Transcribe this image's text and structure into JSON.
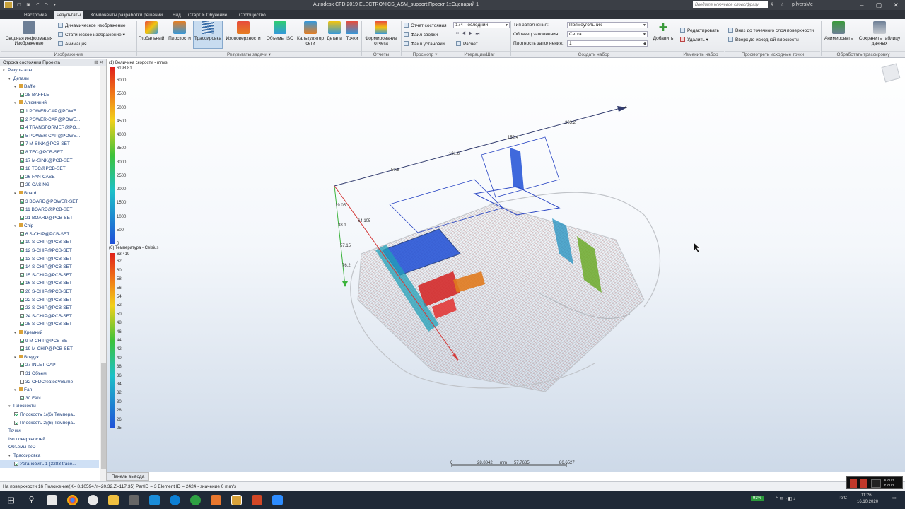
{
  "titlebar": {
    "title": "Autodesk CFD 2019   ELECTRONICS_ASM_support:Проект 1::Сценарий 1",
    "search_placeholder": "Введите ключевое слово/фразу",
    "user": "pilversMe"
  },
  "menu": [
    "Настройка",
    "Результаты",
    "Компоненты разработки решений",
    "Вид",
    "Старт & Обучение",
    "Сообщество"
  ],
  "ribbon": {
    "image": {
      "label": "Сводная информация Изображение",
      "dyn": "Динамическое изображение",
      "static": "Статическое изображение",
      "anim": "Анимация",
      "group": "Изображение"
    },
    "tasks": [
      "Глобальный",
      "Плоскости",
      "Трассировка",
      "Изоповерхности",
      "Объемы ISO",
      "Калькулятор сети",
      "Детали",
      "Точки"
    ],
    "tasks_group": "Результаты задачи",
    "report": {
      "label": "Формирование отчета",
      "group": "Отчеты"
    },
    "review": {
      "status": "Отчет состояния",
      "status_val": "174 Последний",
      "summary": "Файл сводки",
      "setup": "Файл установки",
      "calc": "Расчет",
      "group": "Просмотр",
      "group2": "Итерации/Шаг"
    },
    "set": {
      "type_label": "Тип заполнения:",
      "type_val": "Прямоугольник",
      "pattern_label": "Образец заполнения:",
      "pattern_val": "Сетка",
      "density_label": "Плотность заполнения:",
      "density_val": "1",
      "add": "Добавить",
      "group": "Создать набор"
    },
    "edit": {
      "edit": "Редактировать",
      "delete": "Удалить",
      "group": "Изменить набор"
    },
    "seed": {
      "top": "Вниз до точечного слоя поверхности",
      "up": "Вверх до исходной плоскости",
      "group": "Просмотреть исходные точки"
    },
    "process": {
      "animate": "Анимировать",
      "save": "Сохранить таблицу данных",
      "group": "Обработать трассировку"
    }
  },
  "tree": {
    "header": "Строка состояния Проекта",
    "items": [
      {
        "lvl": 0,
        "kind": "tw",
        "text": "Результаты"
      },
      {
        "lvl": 1,
        "kind": "tw",
        "text": "Детали"
      },
      {
        "lvl": 2,
        "kind": "fo",
        "text": "Baffle"
      },
      {
        "lvl": 3,
        "kind": "on",
        "text": "28 BAFFLE"
      },
      {
        "lvl": 2,
        "kind": "fo",
        "text": "Алюминий"
      },
      {
        "lvl": 3,
        "kind": "on",
        "text": "1 POWER-CAP@POWE..."
      },
      {
        "lvl": 3,
        "kind": "on",
        "text": "2 POWER-CAP@POWE..."
      },
      {
        "lvl": 3,
        "kind": "on",
        "text": "4 TRANSFORMER@PO..."
      },
      {
        "lvl": 3,
        "kind": "on",
        "text": "5 POWER-CAP@POWE..."
      },
      {
        "lvl": 3,
        "kind": "on",
        "text": "7 M-SINK@PCB-SET"
      },
      {
        "lvl": 3,
        "kind": "on",
        "text": "8 TEC@PCB-SET"
      },
      {
        "lvl": 3,
        "kind": "on",
        "text": "17 M-SINK@PCB-SET"
      },
      {
        "lvl": 3,
        "kind": "on",
        "text": "18 TEC@PCB-SET"
      },
      {
        "lvl": 3,
        "kind": "on",
        "text": "26 FAN-CASE"
      },
      {
        "lvl": 3,
        "kind": "off",
        "text": "29 CASING"
      },
      {
        "lvl": 2,
        "kind": "fo",
        "text": "Board"
      },
      {
        "lvl": 3,
        "kind": "on",
        "text": "3 BOARD@POWER-SET"
      },
      {
        "lvl": 3,
        "kind": "on",
        "text": "11 BOARD@PCB-SET"
      },
      {
        "lvl": 3,
        "kind": "on",
        "text": "21 BOARD@PCB-SET"
      },
      {
        "lvl": 2,
        "kind": "fo",
        "text": "Chip"
      },
      {
        "lvl": 3,
        "kind": "on",
        "text": "6 S-CHIP@PCB-SET"
      },
      {
        "lvl": 3,
        "kind": "on",
        "text": "10 S-CHIP@PCB-SET"
      },
      {
        "lvl": 3,
        "kind": "on",
        "text": "12 S-CHIP@PCB-SET"
      },
      {
        "lvl": 3,
        "kind": "on",
        "text": "13 S-CHIP@PCB-SET"
      },
      {
        "lvl": 3,
        "kind": "on",
        "text": "14 S-CHIP@PCB-SET"
      },
      {
        "lvl": 3,
        "kind": "on",
        "text": "15 S-CHIP@PCB-SET"
      },
      {
        "lvl": 3,
        "kind": "on",
        "text": "16 S-CHIP@PCB-SET"
      },
      {
        "lvl": 3,
        "kind": "on",
        "text": "20 S-CHIP@PCB-SET"
      },
      {
        "lvl": 3,
        "kind": "on",
        "text": "22 S-CHIP@PCB-SET"
      },
      {
        "lvl": 3,
        "kind": "on",
        "text": "23 S-CHIP@PCB-SET"
      },
      {
        "lvl": 3,
        "kind": "on",
        "text": "24 S-CHIP@PCB-SET"
      },
      {
        "lvl": 3,
        "kind": "on",
        "text": "25 S-CHIP@PCB-SET"
      },
      {
        "lvl": 2,
        "kind": "fo",
        "text": "Кремний"
      },
      {
        "lvl": 3,
        "kind": "on",
        "text": "9 M-CHIP@PCB-SET"
      },
      {
        "lvl": 3,
        "kind": "on",
        "text": "19 M-CHIP@PCB-SET"
      },
      {
        "lvl": 2,
        "kind": "fo",
        "text": "Воздух"
      },
      {
        "lvl": 3,
        "kind": "on",
        "text": "27 INLET-CAP"
      },
      {
        "lvl": 3,
        "kind": "off",
        "text": "31 Объем"
      },
      {
        "lvl": 3,
        "kind": "off",
        "text": "32 CFDCreatedVolume"
      },
      {
        "lvl": 2,
        "kind": "fo",
        "text": "Fan"
      },
      {
        "lvl": 3,
        "kind": "on",
        "text": "30 FAN"
      },
      {
        "lvl": 1,
        "kind": "tw",
        "text": "Плоскости"
      },
      {
        "lvl": 2,
        "kind": "on",
        "text": "Плоскость 1((6) Темпера..."
      },
      {
        "lvl": 2,
        "kind": "on",
        "text": "Плоскость 2((6) Темпера..."
      },
      {
        "lvl": 1,
        "kind": "leaf",
        "text": "Точки"
      },
      {
        "lvl": 1,
        "kind": "leaf",
        "text": "Iso поверхностей"
      },
      {
        "lvl": 1,
        "kind": "leaf",
        "text": "Объемы ISO"
      },
      {
        "lvl": 1,
        "kind": "tw",
        "text": "Трассировка"
      },
      {
        "lvl": 2,
        "kind": "sel",
        "text": "Установить 1 (3283 trace..."
      }
    ]
  },
  "legend_velocity": {
    "title": "(1) Величина скорости - mm/s",
    "max": "6198.81",
    "ticks": [
      "6000",
      "5500",
      "5000",
      "4500",
      "4000",
      "3500",
      "3000",
      "2500",
      "2000",
      "1500",
      "1000",
      "500",
      "0"
    ]
  },
  "legend_temperature": {
    "title": "(6) Температура - Celsius",
    "max": "63.419",
    "ticks": [
      "62",
      "60",
      "58",
      "56",
      "54",
      "52",
      "50",
      "48",
      "46",
      "44",
      "42",
      "40",
      "38",
      "36",
      "34",
      "32",
      "30",
      "28",
      "26",
      "25"
    ]
  },
  "dimensions": [
    "50.8",
    "131.6",
    "152.4",
    "203.2",
    "19.05",
    "38.1",
    "57.15",
    "76.2",
    "64.105"
  ],
  "axis_label": "Z",
  "scale": {
    "labels": [
      "0",
      "28.8842",
      "mm",
      "57.7685",
      "86.6527"
    ]
  },
  "output_tab": "Панель вывода",
  "status": "На поверхности 16   Положение(X= 8.10594,Y=20.32,Z=117.35) PartID = 3 Element ID = 2424 - значение 0   mm/s",
  "taskbar": {
    "battery": "93%",
    "lang": "РУС",
    "time": "11:26",
    "date": "16.10.2020"
  },
  "minimon": {
    "t1": "X 803",
    "t2": "Y 803"
  },
  "colors": {
    "accent": "#c8dcf0",
    "title_bg": "#3b3f46"
  }
}
